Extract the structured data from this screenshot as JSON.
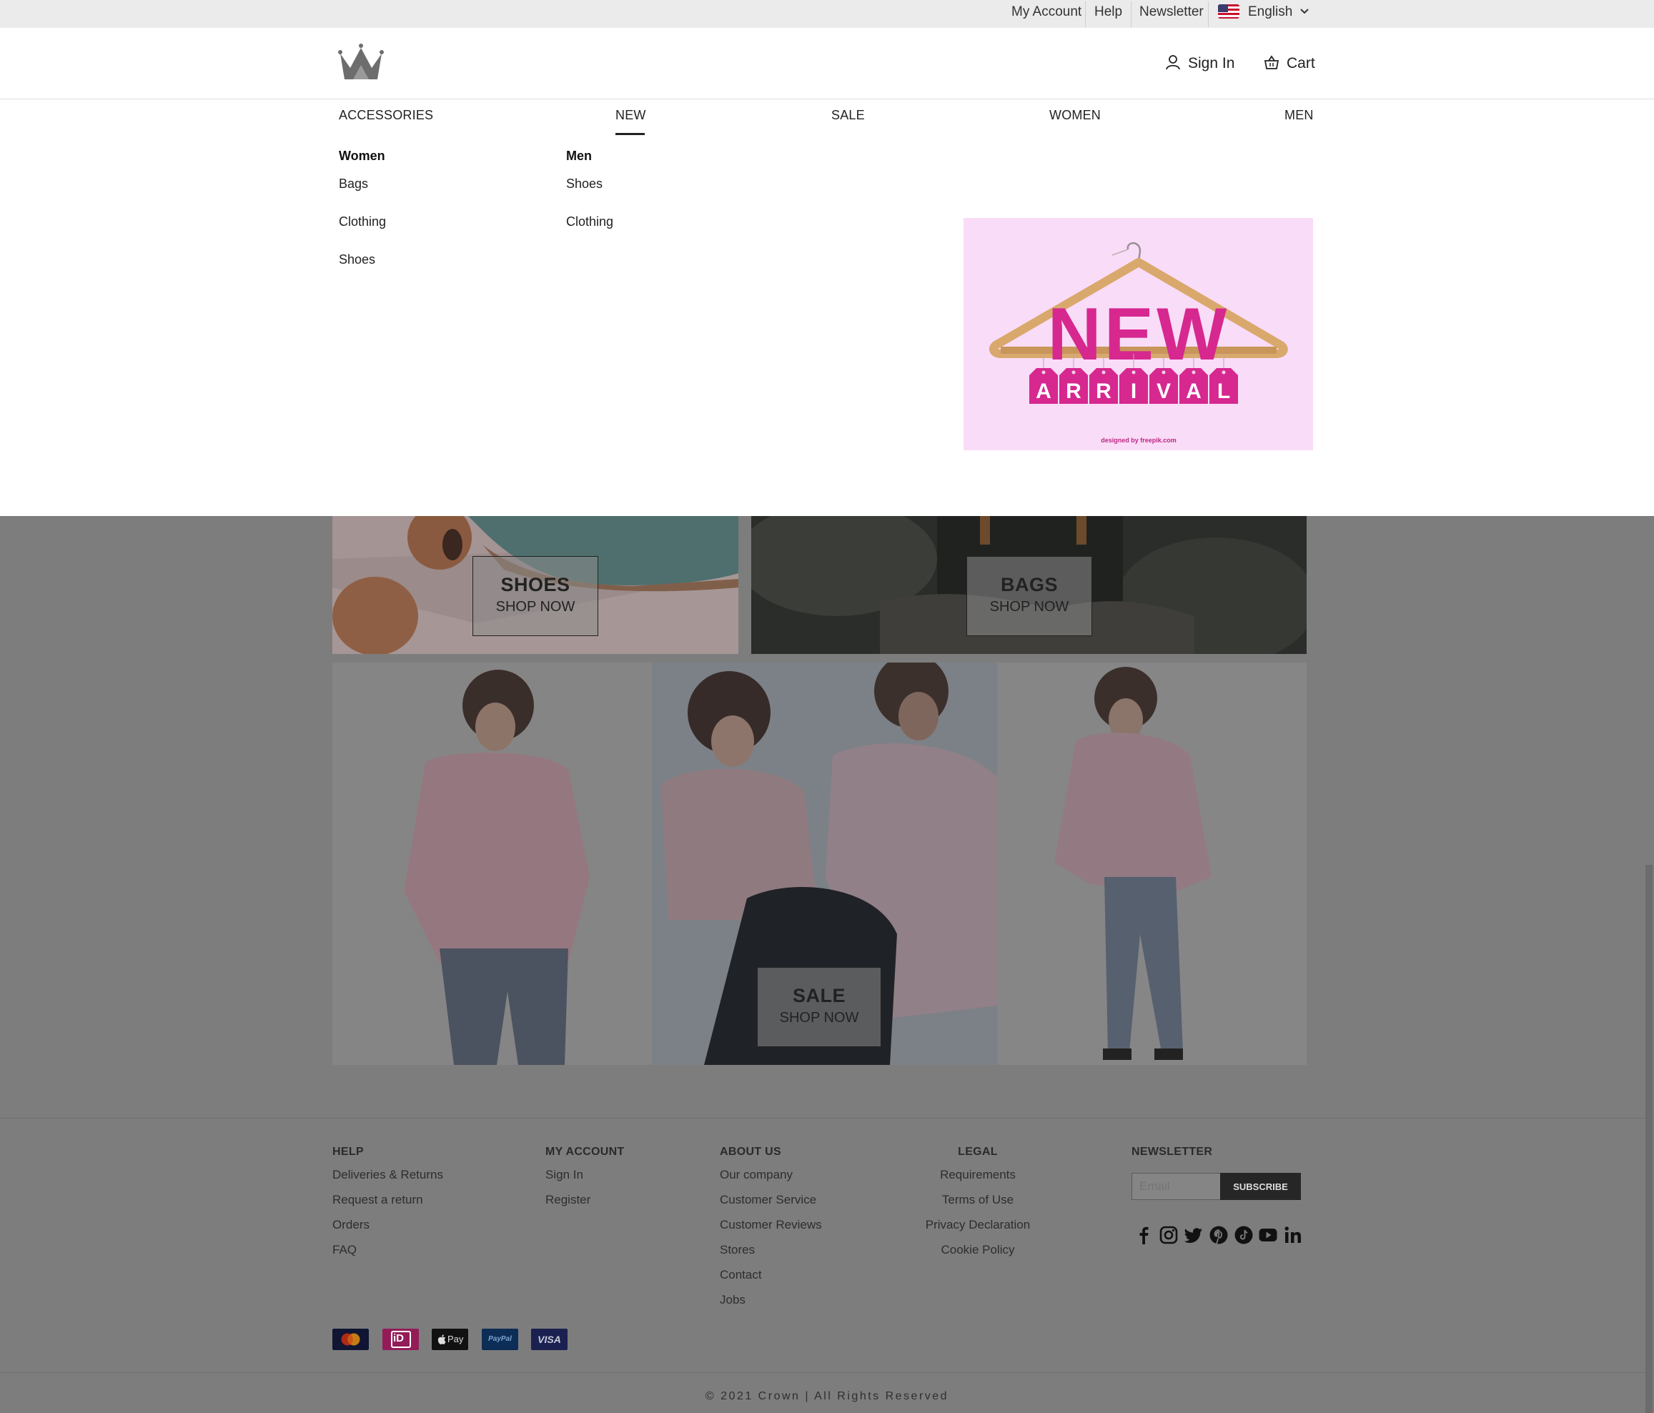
{
  "topbar": {
    "my_account": "My Account",
    "help": "Help",
    "newsletter": "Newsletter",
    "language": "English",
    "flag_icon": "us-flag-icon"
  },
  "header": {
    "logo_icon": "crown-logo-icon",
    "sign_in": "Sign In",
    "cart": "Cart"
  },
  "nav": {
    "items": [
      "ACCESSORIES",
      "NEW",
      "SALE",
      "WOMEN",
      "MEN"
    ],
    "active": "NEW"
  },
  "mega_menu": {
    "women": {
      "title": "Women",
      "links": [
        "Bags",
        "Clothing",
        "Shoes"
      ]
    },
    "men": {
      "title": "Men",
      "links": [
        "Shoes",
        "Clothing"
      ]
    },
    "promo": {
      "big": "NEW",
      "tags": [
        "A",
        "R",
        "R",
        "I",
        "V",
        "A",
        "L"
      ],
      "credit": "designed by freepik.com",
      "bg_color": "#f9dcf7",
      "accent_color": "#d6288f"
    }
  },
  "tiles": {
    "shoes": {
      "title": "SHOES",
      "cta": "SHOP NOW"
    },
    "bags": {
      "title": "BAGS",
      "cta": "SHOP NOW"
    },
    "sale": {
      "title": "SALE",
      "cta": "SHOP NOW"
    }
  },
  "footer": {
    "help": {
      "title": "HELP",
      "links": [
        "Deliveries & Returns",
        "Request a return",
        "Orders",
        "FAQ"
      ]
    },
    "account": {
      "title": "MY ACCOUNT",
      "links": [
        "Sign In",
        "Register"
      ]
    },
    "about": {
      "title": "ABOUT US",
      "links": [
        "Our company",
        "Customer Service",
        "Customer Reviews",
        "Stores",
        "Contact",
        "Jobs"
      ]
    },
    "legal": {
      "title": "LEGAL",
      "links": [
        "Requirements",
        "Terms of Use",
        "Privacy Declaration",
        "Cookie Policy"
      ]
    },
    "newsletter": {
      "title": "NEWSLETTER",
      "placeholder": "Email",
      "button": "SUBSCRIBE"
    },
    "social_icons": [
      "facebook-icon",
      "instagram-icon",
      "twitter-icon",
      "pinterest-icon",
      "tiktok-icon",
      "youtube-icon",
      "linkedin-icon"
    ],
    "payment_icons": [
      "mastercard-icon",
      "ideal-icon",
      "apple-pay-icon",
      "paypal-icon",
      "visa-icon"
    ],
    "payment_labels": {
      "apple_pay": "Pay",
      "paypal": "PayPal",
      "visa": "VISA",
      "ideal": "iD"
    },
    "copyright": "© 2021 Crown | All Rights Reserved"
  }
}
